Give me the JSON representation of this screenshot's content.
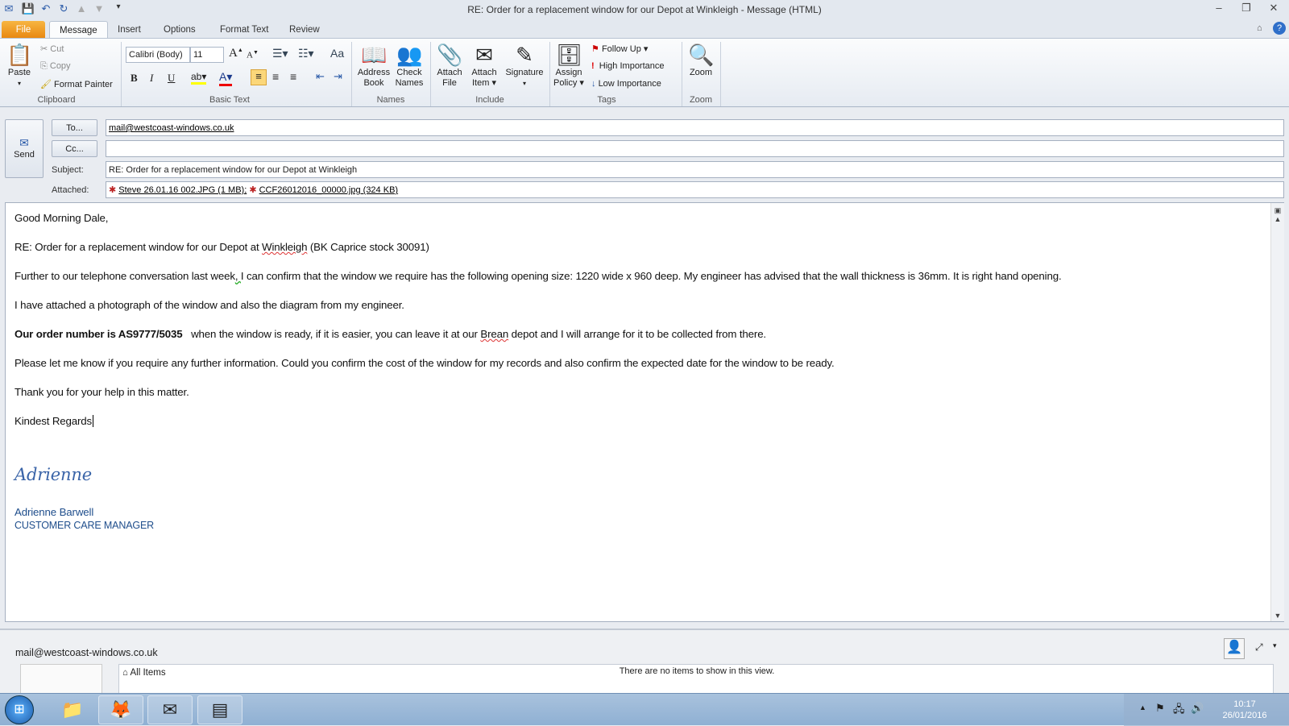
{
  "window": {
    "title": "RE: Order for a replacement window for our Depot at Winkleigh  -  Message (HTML)"
  },
  "tabs": [
    "File",
    "Message",
    "Insert",
    "Options",
    "Format Text",
    "Review"
  ],
  "ribbon": {
    "clipboard": {
      "label": "Clipboard",
      "paste": "Paste",
      "cut": "Cut",
      "copy": "Copy",
      "format_painter": "Format Painter"
    },
    "basic_text": {
      "label": "Basic Text",
      "font": "Calibri (Body)",
      "size": "11",
      "bold": "B",
      "italic": "I",
      "underline": "U"
    },
    "names": {
      "label": "Names",
      "address_book": [
        "Address",
        "Book"
      ],
      "check_names": [
        "Check",
        "Names"
      ]
    },
    "include": {
      "label": "Include",
      "attach_file": [
        "Attach",
        "File"
      ],
      "attach_item": [
        "Attach",
        "Item ▾"
      ],
      "signature": "Signature"
    },
    "tags": {
      "label": "Tags",
      "assign_policy": [
        "Assign",
        "Policy ▾"
      ],
      "follow_up": "Follow Up",
      "high": "High Importance",
      "low": "Low Importance"
    },
    "zoom": {
      "label": "Zoom",
      "zoom": "Zoom"
    }
  },
  "compose": {
    "send": "Send",
    "to_btn": "To...",
    "cc_btn": "Cc...",
    "subject_label": "Subject:",
    "attached_label": "Attached:",
    "to": "mail@westcoast-windows.co.uk",
    "cc": "",
    "subject": "RE: Order for a replacement window for our Depot at Winkleigh",
    "attachments": [
      "Steve 26.01.16 002.JPG (1 MB);",
      "CCF26012016_00000.jpg (324 KB)"
    ]
  },
  "body": {
    "greeting": "Good Morning Dale,",
    "re_line": {
      "a": "RE: Order for a replacement window for our Depot at ",
      "b": "Winkleigh",
      "c": " (BK Caprice stock 30091)"
    },
    "p1": {
      "a": "Further to our telephone conversation last week",
      "b": ",  ",
      "c": "I can confirm that the window we require has the following opening size: 1220 wide x 960 deep.  My engineer has advised that the wall thickness is 36mm. It is right hand opening."
    },
    "p2": "I have attached a photograph of the window and also the diagram from my engineer.",
    "p3": {
      "bold": "Our order number is AS9777/5035",
      "a": "   when the window is ready, if it is easier, you can leave it at our ",
      "b": "Brean",
      "c": " depot and I will arrange for it to be collected from there."
    },
    "p4": "Please let me know if you require any further information.  Could you confirm the cost of the window for my records and also confirm the expected date for the window to be ready.",
    "p5": "Thank you for your help in this matter.",
    "closing": "Kindest Regards",
    "signature_script": "Adrienne",
    "sig_name": "Adrienne Barwell",
    "sig_title": "CUSTOMER CARE MANAGER"
  },
  "people_pane": {
    "email": "mail@westcoast-windows.co.uk",
    "all_items": "All Items",
    "empty": "There are no items to show in this view."
  },
  "taskbar": {
    "time": "10:17",
    "date": "26/01/2016"
  }
}
